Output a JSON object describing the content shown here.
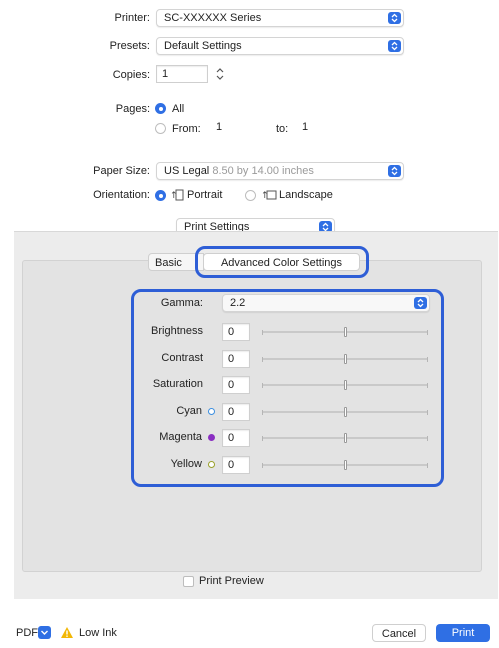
{
  "printer": {
    "label": "Printer:",
    "value": "SC-XXXXXX Series"
  },
  "presets": {
    "label": "Presets:",
    "value": "Default Settings"
  },
  "copies": {
    "label": "Copies:",
    "value": "1"
  },
  "pages": {
    "label": "Pages:",
    "all_label": "All",
    "from_label": "From:",
    "from_value": "1",
    "to_label": "to:",
    "to_value": "1"
  },
  "paper_size": {
    "label": "Paper Size:",
    "value": "US Legal",
    "detail": "8.50 by 14.00 inches"
  },
  "orientation": {
    "label": "Orientation:",
    "portrait": "Portrait",
    "landscape": "Landscape"
  },
  "section_select": {
    "value": "Print Settings"
  },
  "tabs": {
    "basic": "Basic",
    "advanced": "Advanced Color Settings"
  },
  "color": {
    "gamma_label": "Gamma:",
    "gamma_value": "2.2",
    "sliders": [
      {
        "label": "Brightness",
        "value": "0",
        "level": 0.5,
        "dot": ""
      },
      {
        "label": "Contrast",
        "value": "0",
        "level": 0.5,
        "dot": ""
      },
      {
        "label": "Saturation",
        "value": "0",
        "level": 0.5,
        "dot": ""
      },
      {
        "label": "Cyan",
        "value": "0",
        "level": 0.5,
        "dot": "cyan"
      },
      {
        "label": "Magenta",
        "value": "0",
        "level": 0.5,
        "dot": "magenta"
      },
      {
        "label": "Yellow",
        "value": "0",
        "level": 0.5,
        "dot": "yellow"
      }
    ]
  },
  "print_preview": "Print Preview",
  "footer": {
    "pdf": "PDF",
    "low_ink": "Low Ink",
    "cancel": "Cancel",
    "print": "Print"
  },
  "colors": {
    "accent": "#2f6fe4",
    "highlight": "#2e5ed6",
    "cyan_dot": "#3c8fe0",
    "magenta_dot": "#8a2fc2",
    "yellow_dot": "#9aa02a",
    "warning": "#f2b705"
  }
}
